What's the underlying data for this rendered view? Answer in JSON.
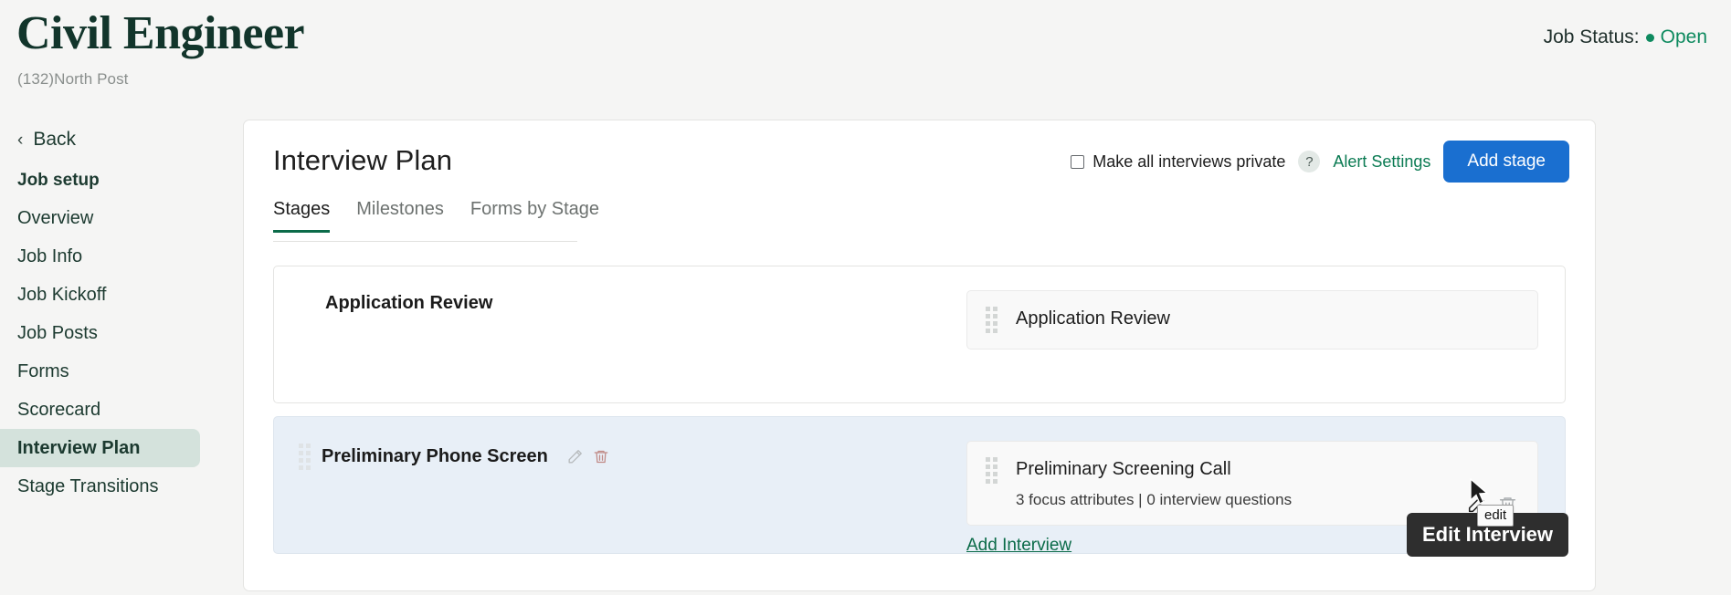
{
  "header": {
    "job_title": "Civil Engineer",
    "job_subtitle": "(132)North Post",
    "status_label": "Job Status:",
    "status_value": "Open",
    "status_color": "#0e8a5f"
  },
  "sidebar": {
    "back_label": "Back",
    "back_icon": "chevron-left-icon",
    "group_label": "Job setup",
    "items": [
      {
        "label": "Overview",
        "active": false
      },
      {
        "label": "Job Info",
        "active": false
      },
      {
        "label": "Job Kickoff",
        "active": false
      },
      {
        "label": "Job Posts",
        "active": false
      },
      {
        "label": "Forms",
        "active": false
      },
      {
        "label": "Scorecard",
        "active": false
      },
      {
        "label": "Interview Plan",
        "active": true
      },
      {
        "label": "Stage Transitions",
        "active": false
      }
    ],
    "active_bg": "#d4e2dc"
  },
  "panel": {
    "title": "Interview Plan",
    "private_checkbox_label": "Make all interviews private",
    "private_checkbox_checked": false,
    "help_icon": "question-mark-icon",
    "help_icon_glyph": "?",
    "alert_settings_label": "Alert Settings",
    "add_stage_label": "Add stage",
    "add_stage_color": "#1a6fd0",
    "link_color": "#0b7b53"
  },
  "tabs": [
    {
      "label": "Stages",
      "active": true
    },
    {
      "label": "Milestones",
      "active": false
    },
    {
      "label": "Forms by Stage",
      "active": false
    }
  ],
  "stages": [
    {
      "name": "Application Review",
      "highlighted": false,
      "has_drag_handle": false,
      "has_row_icons": false,
      "interviews": [
        {
          "title": "Application Review",
          "meta": "",
          "has_actions": false
        }
      ],
      "add_interview_label": ""
    },
    {
      "name": "Preliminary Phone Screen",
      "highlighted": true,
      "has_drag_handle": true,
      "has_row_icons": true,
      "edit_icon": "pencil-icon",
      "delete_icon": "trash-icon",
      "interviews": [
        {
          "title": "Preliminary Screening Call",
          "meta": "3 focus attributes | 0 interview questions",
          "has_actions": true,
          "edit_icon": "pencil-icon",
          "delete_icon": "trash-icon"
        }
      ],
      "add_interview_label": "Add Interview"
    }
  ],
  "tooltips": {
    "dark_tooltip": "Edit Interview",
    "native_tooltip": "edit"
  }
}
